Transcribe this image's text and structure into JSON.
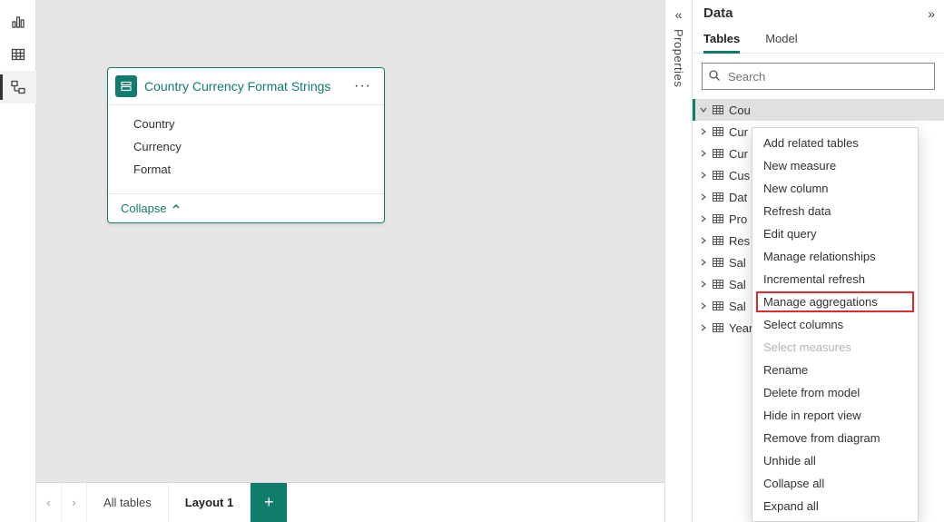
{
  "rail": {
    "items": [
      {
        "name": "report-view-icon",
        "active": false
      },
      {
        "name": "data-view-icon",
        "active": false
      },
      {
        "name": "model-view-icon",
        "active": true
      }
    ]
  },
  "card": {
    "title": "Country Currency Format Strings",
    "more_label": "···",
    "fields": [
      "Country",
      "Currency",
      "Format"
    ],
    "collapse_label": "Collapse"
  },
  "bottom_tabs": {
    "nav_prev": "‹",
    "nav_next": "›",
    "items": [
      {
        "label": "All tables",
        "active": false
      },
      {
        "label": "Layout 1",
        "active": true
      }
    ],
    "add_label": "+"
  },
  "properties": {
    "expand_icon": "«",
    "label": "Properties"
  },
  "data_pane": {
    "title": "Data",
    "collapse_icon": "»",
    "tabs": [
      {
        "label": "Tables",
        "active": true
      },
      {
        "label": "Model",
        "active": false
      }
    ],
    "search": {
      "placeholder": "Search"
    },
    "tree": [
      {
        "label": "Cou",
        "selected": true,
        "expanded": true
      },
      {
        "label": "Cur"
      },
      {
        "label": "Cur"
      },
      {
        "label": "Cus"
      },
      {
        "label": "Dat"
      },
      {
        "label": "Pro"
      },
      {
        "label": "Res"
      },
      {
        "label": "Sal"
      },
      {
        "label": "Sal"
      },
      {
        "label": "Sal"
      },
      {
        "label": "Year"
      }
    ]
  },
  "context_menu": {
    "items": [
      {
        "label": "Add related tables"
      },
      {
        "label": "New measure"
      },
      {
        "label": "New column"
      },
      {
        "label": "Refresh data"
      },
      {
        "label": "Edit query"
      },
      {
        "label": "Manage relationships"
      },
      {
        "label": "Incremental refresh"
      },
      {
        "label": "Manage aggregations",
        "highlighted": true
      },
      {
        "label": "Select columns"
      },
      {
        "label": "Select measures",
        "disabled": true
      },
      {
        "label": "Rename"
      },
      {
        "label": "Delete from model"
      },
      {
        "label": "Hide in report view"
      },
      {
        "label": "Remove from diagram"
      },
      {
        "label": "Unhide all"
      },
      {
        "label": "Collapse all"
      },
      {
        "label": "Expand all"
      }
    ]
  }
}
